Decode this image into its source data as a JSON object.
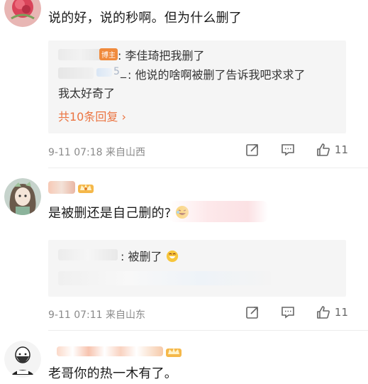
{
  "comments": [
    {
      "text": "说的好，说的秒啊。但为什么删了",
      "replies": [
        {
          "author_tag": "博主",
          "text": ": 李佳琦把我删了"
        },
        {
          "author_suffix": "_",
          "text": ": 他说的啥啊被删了告诉我吧求求了",
          "text_cont": "我太好奇了"
        }
      ],
      "more_label": "共10条回复 ›",
      "meta": "9-11 07:18  来自山西",
      "like_count": "11"
    },
    {
      "text": "是被删还是自己删的?",
      "replies": [
        {
          "text": ": 被删了"
        }
      ],
      "meta": "9-11 07:11  来自山东",
      "like_count": "11"
    },
    {
      "text": "老哥你的热一木有了。"
    }
  ],
  "icons": {
    "share": "share-icon",
    "comment": "comment-icon",
    "like": "thumbs-up-icon",
    "laugh": "laugh-emoji-icon",
    "crown": "crown-badge-icon"
  },
  "colors": {
    "link": "#eb7340",
    "meta": "#8a8a8a",
    "reply_bg": "#f5f5f5"
  }
}
